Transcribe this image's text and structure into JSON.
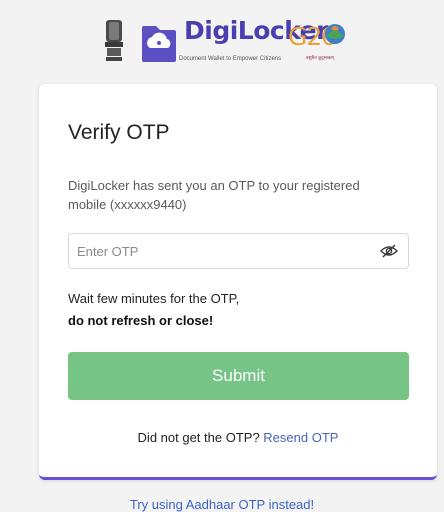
{
  "header": {
    "brand_title": "DigiLocker",
    "brand_tagline": "Document Wallet to Empower Citizens",
    "g20_text": "G20",
    "g20_sub": "वसुधैव कुटुम्बकम्",
    "emblem_icon": "national-emblem-icon",
    "brand_icon": "digilocker-cloud-icon",
    "brand_color": "#4b3fb0"
  },
  "card": {
    "title": "Verify OTP",
    "description": "DigiLocker has sent you an OTP to your registered mobile (xxxxxx9440)",
    "otp_input": {
      "placeholder": "Enter OTP",
      "value": ""
    },
    "eye_icon": "eye-slash-icon",
    "wait_text": "Wait few minutes for the OTP,",
    "warning_text": "do not refresh or close!",
    "submit_label": "Submit",
    "submit_color": "#76c486",
    "resend_prefix": "Did not get the OTP?",
    "resend_link": "Resend OTP",
    "accent_border": "#6a4fd6"
  },
  "footer": {
    "aadhaar_link": "Try using Aadhaar OTP instead!"
  }
}
